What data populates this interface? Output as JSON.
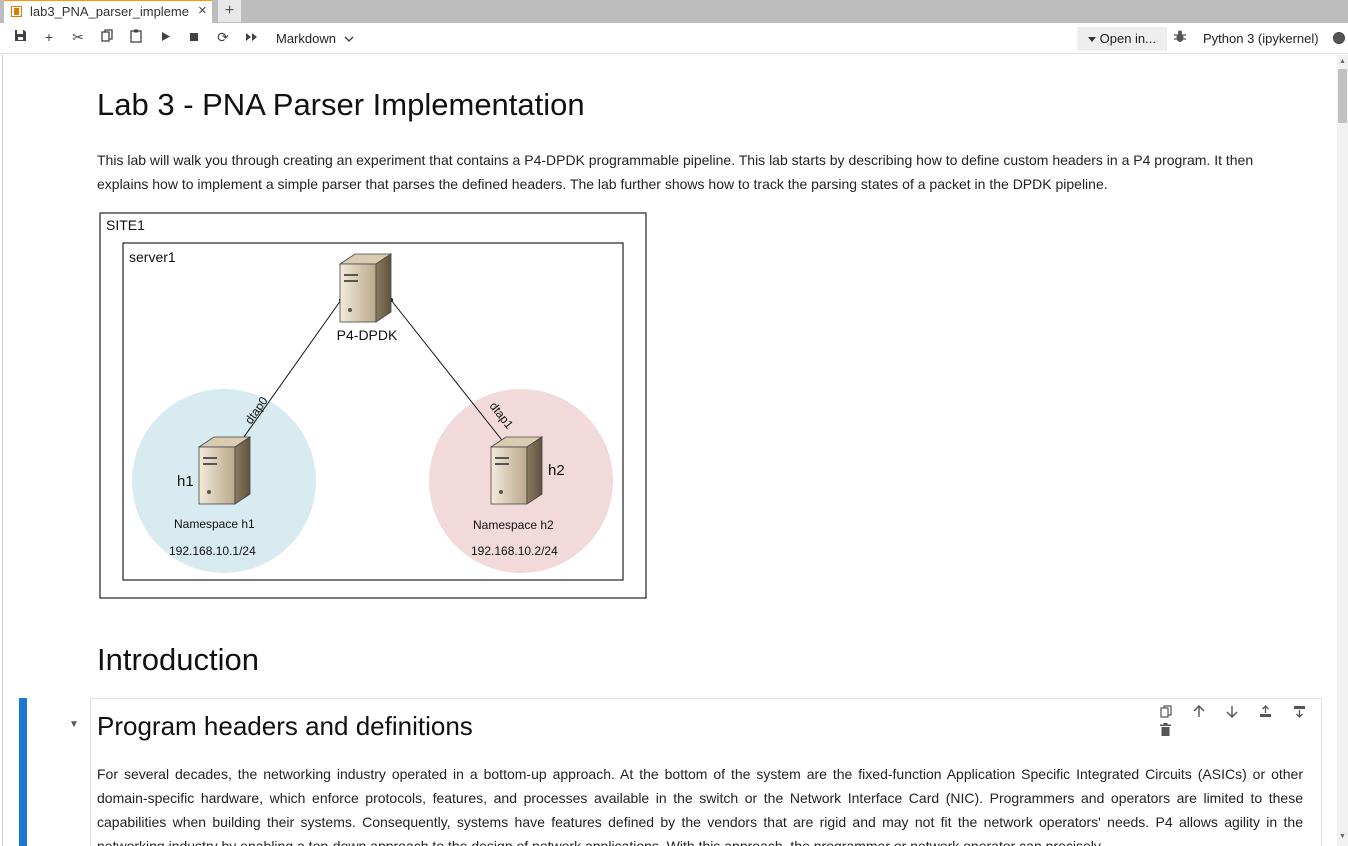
{
  "tab": {
    "title": "lab3_PNA_parser_impleme",
    "close_label": "×",
    "new_label": "+"
  },
  "toolbar": {
    "cell_type": "Markdown",
    "open_in": "Open in...",
    "kernel": "Python 3 (ipykernel)"
  },
  "notebook": {
    "title": "Lab 3 - PNA Parser Implementation",
    "intro": "This lab will walk you through creating an experiment that contains a P4-DPDK programmable pipeline. This lab starts by describing how to define custom headers in a P4 program. It then explains how to implement a simple parser that parses the defined headers. The lab further shows how to track the parsing states of a packet in the DPDK pipeline.",
    "diagram": {
      "site": "SITE1",
      "server": "server1",
      "switch": "P4-DPDK",
      "h1_label": "h1",
      "h2_label": "h2",
      "link1": "dtap0",
      "link2": "dtap1",
      "ns1": "Namespace h1",
      "ns2": "Namespace h2",
      "ip1": "192.168.10.1/24",
      "ip2": "192.168.10.2/24"
    },
    "section_heading": "Introduction",
    "subsection_heading": "Program headers and definitions",
    "body": "For several decades, the networking industry operated in a bottom-up approach. At the bottom of the system are the fixed-function Application Specific Integrated Circuits (ASICs) or other domain-specific hardware, which enforce protocols, features, and processes available in the switch or the Network Interface Card (NIC). Programmers and operators are limited to these capabilities when building their systems. Consequently, systems have features defined by the vendors that are rigid and may not fit the network operators' needs. P4 allows agility in the networking industry by enabling a top-down approach to the design of network applications. With this approach, the programmer or network operator can precisely"
  }
}
